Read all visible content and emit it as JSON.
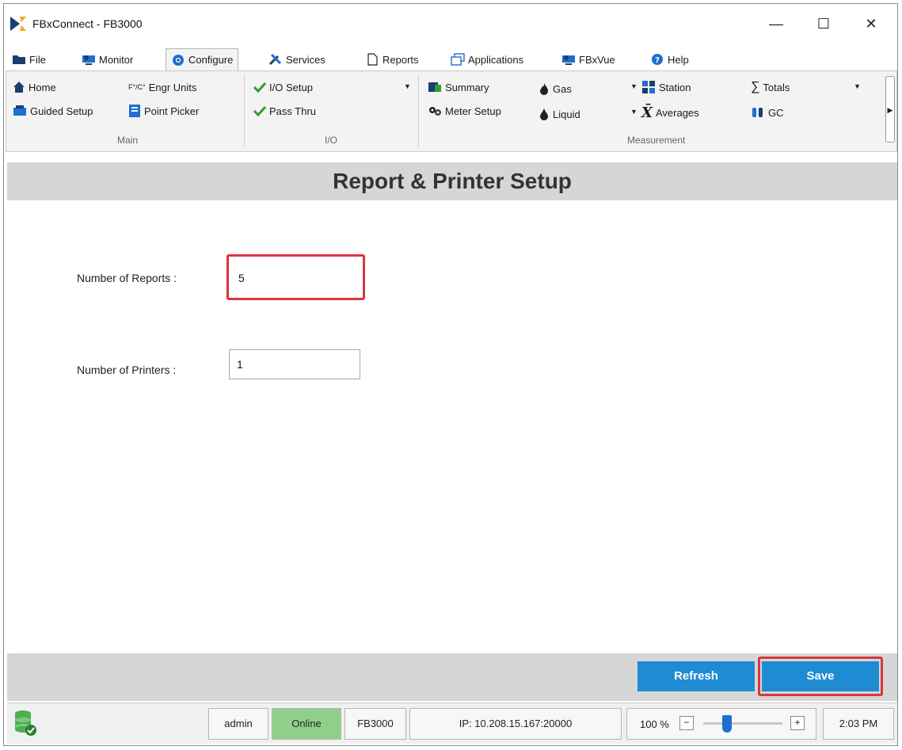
{
  "window": {
    "title": "FBxConnect - FB3000",
    "minimize_glyph": "—",
    "maximize_glyph": "☐",
    "close_glyph": "✕"
  },
  "tabs": [
    {
      "label": "File",
      "icon": "folder-icon"
    },
    {
      "label": "Monitor",
      "icon": "monitor-icon"
    },
    {
      "label": "Configure",
      "icon": "gear-icon",
      "active": true
    },
    {
      "label": "Services",
      "icon": "tools-icon"
    },
    {
      "label": "Reports",
      "icon": "document-icon"
    },
    {
      "label": "Applications",
      "icon": "applications-icon"
    },
    {
      "label": "FBxVue",
      "icon": "fbxvue-icon"
    },
    {
      "label": "Help",
      "icon": "help-icon"
    }
  ],
  "ribbon": {
    "main": {
      "label": "Main",
      "home": "Home",
      "engr_units_prefix": "F°/C°",
      "engr_units": "Engr Units",
      "guided_setup": "Guided Setup",
      "point_picker": "Point Picker"
    },
    "io": {
      "label": "I/O",
      "io_setup": "I/O Setup",
      "pass_thru": "Pass Thru"
    },
    "measurement": {
      "label": "Measurement",
      "summary": "Summary",
      "meter_setup": "Meter Setup",
      "gas": "Gas",
      "liquid": "Liquid",
      "station": "Station",
      "averages": "Averages",
      "averages_symbol": "X̄",
      "totals": "Totals",
      "totals_symbol": "∑",
      "gc": "GC"
    }
  },
  "page": {
    "title": "Report & Printer Setup",
    "fields": {
      "reports_label": "Number of Reports :",
      "reports_value": "5",
      "printers_label": "Number of Printers :",
      "printers_value": "1"
    }
  },
  "buttons": {
    "refresh": "Refresh",
    "save": "Save"
  },
  "status": {
    "user": "admin",
    "connection": "Online",
    "device": "FB3000",
    "ip": "IP: 10.208.15.167:20000",
    "zoom": "100 %",
    "zoom_minus": "−",
    "zoom_plus": "+",
    "time": "2:03 PM"
  },
  "colors": {
    "accent_blue": "#1e8bd3",
    "highlight_red": "#d9363e",
    "online_green": "#8fd18a"
  }
}
